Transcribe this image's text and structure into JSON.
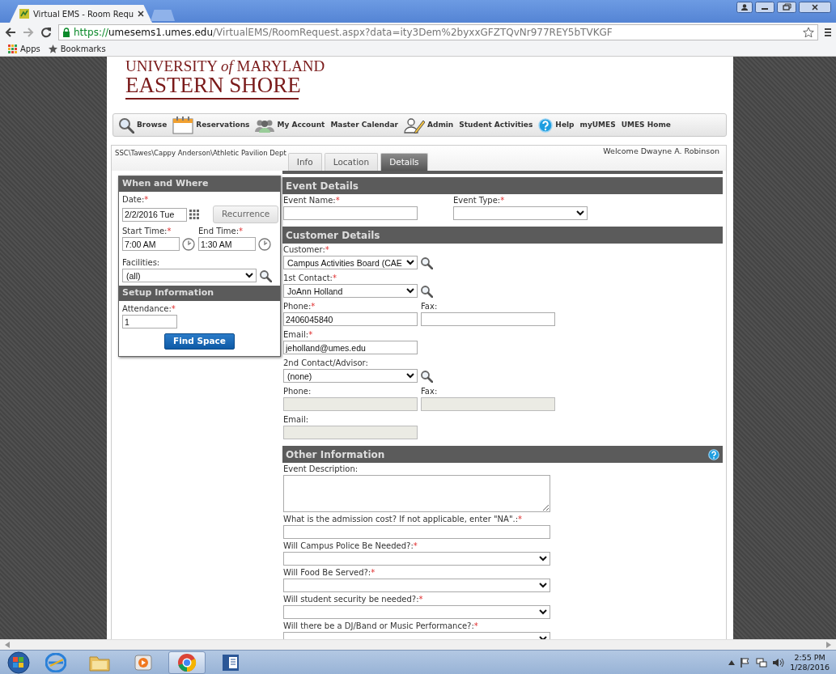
{
  "browser": {
    "tab_title": "Virtual EMS - Room Requ",
    "url_scheme": "https://",
    "url_host": "umesems1.umes.edu",
    "url_path": "/VirtualEMS/RoomRequest.aspx?data=ity3Dem%2byxxGFZTQvNr977REY5bTVKGF",
    "bookmarks": [
      "Apps",
      "Bookmarks"
    ]
  },
  "logo": {
    "line1": "UNIVERSITY *of* MARYLAND",
    "line2": "EASTERN SHORE"
  },
  "nav": [
    {
      "label": "Browse",
      "kind": "search"
    },
    {
      "label": "Reservations",
      "kind": "calendar"
    },
    {
      "label": "My Account",
      "kind": "people"
    },
    {
      "label": "Master Calendar",
      "kind": "plain"
    },
    {
      "label": "Admin",
      "kind": "pen"
    },
    {
      "label": "Student Activities",
      "kind": "plain"
    },
    {
      "label": "Help",
      "kind": "help"
    },
    {
      "label": "myUMES",
      "kind": "plain"
    },
    {
      "label": "UMES Home",
      "kind": "plain"
    }
  ],
  "breadcrumb": "SSC\\Tawes\\Cappy Anderson\\Athletic Pavilion Dept",
  "welcome": "Welcome Dwayne A. Robinson",
  "tabs": [
    {
      "label": "Info",
      "selected": false
    },
    {
      "label": "Location",
      "selected": false
    },
    {
      "label": "Details",
      "selected": true
    }
  ],
  "required_mark": "*",
  "when_where": {
    "title": "When and Where",
    "date": {
      "label": "Date:",
      "required": true,
      "value": "2/2/2016 Tue"
    },
    "recurrence_button": "Recurrence",
    "start_time": {
      "label": "Start Time:",
      "required": true,
      "value": "7:00 AM"
    },
    "end_time": {
      "label": "End Time:",
      "required": true,
      "value": "1:30 AM"
    },
    "facilities": {
      "label": "Facilities:",
      "required": false,
      "value": "(all)"
    }
  },
  "setup": {
    "title": "Setup Information",
    "attendance": {
      "label": "Attendance:",
      "required": true,
      "value": "1"
    },
    "find_button": "Find Space"
  },
  "sections": [
    {
      "title": "Event Details",
      "help": false,
      "rows": [
        [
          {
            "label": "Event Name:",
            "required": true,
            "kind": "text",
            "disabled": false
          },
          {
            "label": "Event Type:",
            "required": true,
            "kind": "select",
            "disabled": false
          }
        ]
      ]
    },
    {
      "title": "Customer Details",
      "help": false,
      "rows": [
        [
          {
            "label": "Customer:",
            "required": true,
            "kind": "select",
            "value": "Campus Activities Board (CAE",
            "search": true,
            "disabled": false
          }
        ],
        [
          {
            "label": "1st Contact:",
            "required": true,
            "kind": "select",
            "value": "JoAnn Holland",
            "search": true,
            "disabled": false
          }
        ],
        [
          {
            "label": "Phone:",
            "required": true,
            "kind": "text",
            "value": "2406045840",
            "disabled": false
          },
          {
            "label": "Fax:",
            "required": false,
            "kind": "text",
            "disabled": false
          }
        ],
        [
          {
            "label": "Email:",
            "required": true,
            "kind": "text",
            "value": "jeholland@umes.edu",
            "disabled": false
          }
        ],
        [
          {
            "label": "2nd Contact/Advisor:",
            "required": false,
            "kind": "select",
            "value": "(none)",
            "search": true,
            "disabled": false
          }
        ],
        [
          {
            "label": "Phone:",
            "required": false,
            "kind": "text",
            "disabled": true
          },
          {
            "label": "Fax:",
            "required": false,
            "kind": "text",
            "disabled": true
          }
        ],
        [
          {
            "label": "Email:",
            "required": false,
            "kind": "text",
            "disabled": true
          }
        ]
      ]
    },
    {
      "title": "Other Information",
      "help": true,
      "rows": [
        [
          {
            "label": "Event Description:",
            "required": false,
            "kind": "textarea",
            "disabled": false
          }
        ],
        [
          {
            "label": "What is the admission cost? If not applicable, enter \"NA\".:",
            "required": true,
            "kind": "text",
            "disabled": false
          }
        ],
        [
          {
            "label": "Will Campus Police Be Needed?:",
            "required": true,
            "kind": "select",
            "disabled": false
          }
        ],
        [
          {
            "label": "Will Food Be Served?:",
            "required": true,
            "kind": "select",
            "disabled": false
          }
        ],
        [
          {
            "label": "Will student security be needed?:",
            "required": true,
            "kind": "select",
            "disabled": false
          }
        ],
        [
          {
            "label": "Will there be a DJ/Band or Music Performance?:",
            "required": true,
            "kind": "select",
            "disabled": false
          }
        ]
      ]
    }
  ],
  "taskbar": {
    "apps": [
      {
        "kind": "browser-e",
        "selected": false
      },
      {
        "kind": "folder",
        "selected": false
      },
      {
        "kind": "media",
        "selected": false
      },
      {
        "kind": "chrome",
        "selected": true
      },
      {
        "kind": "document",
        "selected": false
      }
    ],
    "time": "2:55 PM",
    "date": "1/28/2016"
  }
}
